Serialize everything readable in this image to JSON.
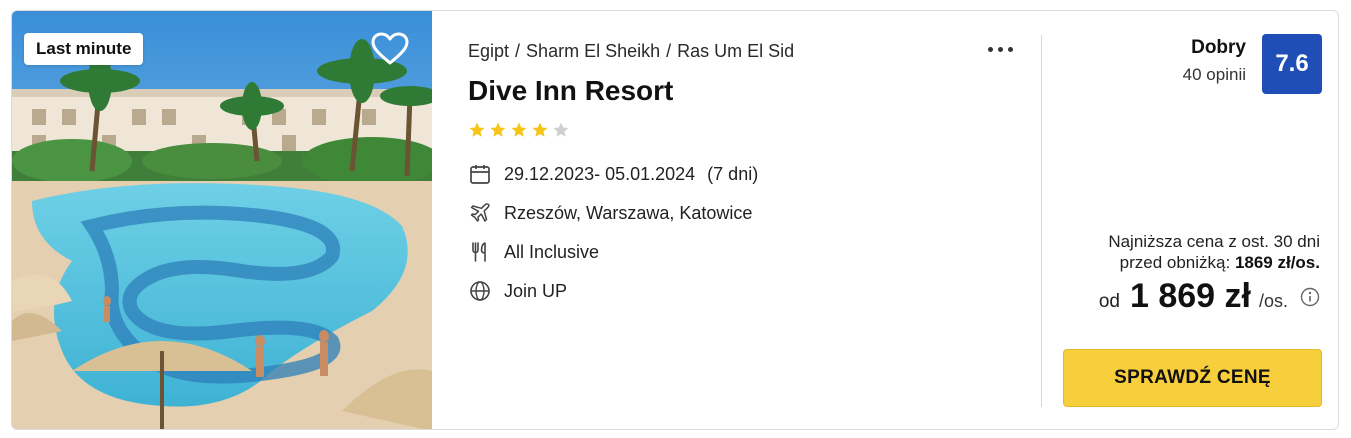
{
  "badge": "Last minute",
  "breadcrumb": [
    "Egipt",
    "Sharm El Sheikh",
    "Ras Um El Sid"
  ],
  "hotel_name": "Dive Inn Resort",
  "stars": {
    "filled": 4,
    "total": 5,
    "color": "#f5c518",
    "empty_color": "#cfcfcf"
  },
  "dates": "29.12.2023- 05.01.2024",
  "duration": "(7 dni)",
  "departures": "Rzeszów, Warszawa, Katowice",
  "board": "All Inclusive",
  "operator": "Join UP",
  "rating": {
    "word": "Dobry",
    "reviews": "40 opinii",
    "score": "7.6",
    "color": "#1f4fb6"
  },
  "lowest_price": {
    "line1": "Najniższa cena z ost. 30 dni",
    "line2_prefix": "przed obniżką:",
    "line2_value": "1869 zł/os."
  },
  "price": {
    "prefix": "od",
    "amount": "1 869 zł",
    "per": "/os."
  },
  "cta": {
    "label": "SPRAWDŹ CENĘ",
    "color": "#f7cf3c"
  },
  "icons": {
    "favorite": "heart-icon",
    "more": "more-dots-icon",
    "calendar": "calendar-icon",
    "flight": "plane-icon",
    "board": "cutlery-icon",
    "operator": "globe-icon",
    "info": "info-icon"
  }
}
